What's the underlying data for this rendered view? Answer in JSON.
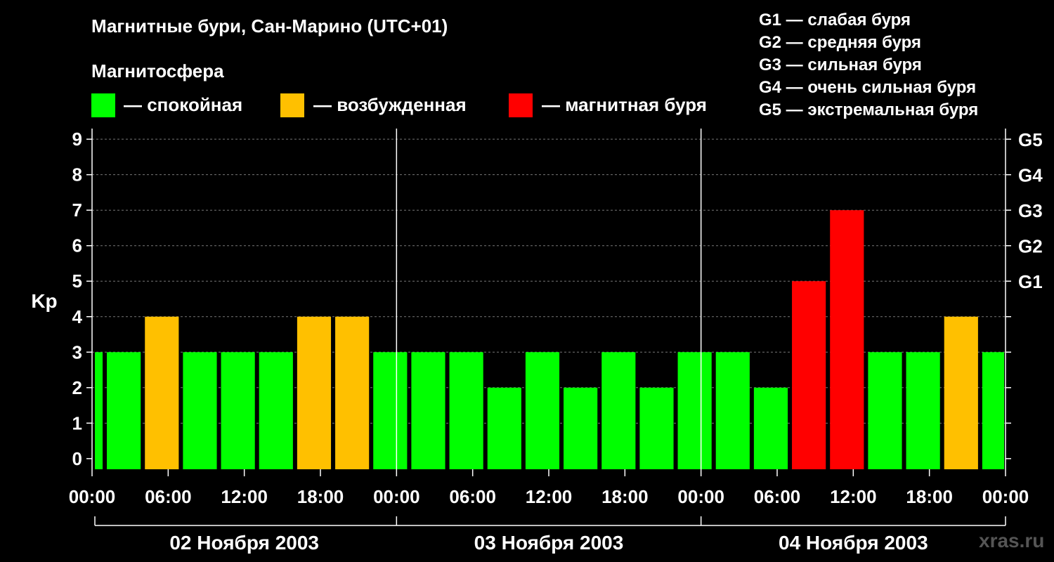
{
  "header": {
    "title": "Магнитные бури, Сан-Марино (UTC+01)",
    "magnetosphere_label": "Магнитосфера"
  },
  "legend": [
    {
      "label": "— спокойная",
      "color": "#00ff00"
    },
    {
      "label": "— возбужденная",
      "color": "#ffc000"
    },
    {
      "label": "— магнитная буря",
      "color": "#ff0000"
    }
  ],
  "g_scale_legend": [
    "G1 — слабая буря",
    "G2 — средняя буря",
    "G3 — сильная буря",
    "G4 — очень сильная буря",
    "G5 — экстремальная буря"
  ],
  "watermark": "xras.ru",
  "chart_data": {
    "type": "bar",
    "ylabel": "Kp",
    "ylim": [
      -0.3,
      9.3
    ],
    "y_ticks": [
      0,
      1,
      2,
      3,
      4,
      5,
      6,
      7,
      8,
      9
    ],
    "g_levels": [
      {
        "label": "G1",
        "kp": 5
      },
      {
        "label": "G2",
        "kp": 6
      },
      {
        "label": "G3",
        "kp": 7
      },
      {
        "label": "G4",
        "kp": 8
      },
      {
        "label": "G5",
        "kp": 9
      }
    ],
    "x_start": "2003-11-02 00:00",
    "x_end": "2003-11-05 00:00",
    "x_tick_labels": [
      "00:00",
      "06:00",
      "12:00",
      "18:00",
      "00:00",
      "06:00",
      "12:00",
      "18:00",
      "00:00",
      "06:00",
      "12:00",
      "18:00",
      "00:00"
    ],
    "days": [
      "02 Ноября 2003",
      "03 Ноября 2003",
      "04 Ноября 2003"
    ],
    "grid": true,
    "bars": [
      {
        "start": "2003-11-02 00:00",
        "end": "2003-11-02 01:00",
        "kp": 3,
        "state": "quiet"
      },
      {
        "start": "2003-11-02 01:00",
        "end": "2003-11-02 04:00",
        "kp": 3,
        "state": "quiet"
      },
      {
        "start": "2003-11-02 04:00",
        "end": "2003-11-02 07:00",
        "kp": 4,
        "state": "active"
      },
      {
        "start": "2003-11-02 07:00",
        "end": "2003-11-02 10:00",
        "kp": 3,
        "state": "quiet"
      },
      {
        "start": "2003-11-02 10:00",
        "end": "2003-11-02 13:00",
        "kp": 3,
        "state": "quiet"
      },
      {
        "start": "2003-11-02 13:00",
        "end": "2003-11-02 16:00",
        "kp": 3,
        "state": "quiet"
      },
      {
        "start": "2003-11-02 16:00",
        "end": "2003-11-02 19:00",
        "kp": 4,
        "state": "active"
      },
      {
        "start": "2003-11-02 19:00",
        "end": "2003-11-02 22:00",
        "kp": 4,
        "state": "active"
      },
      {
        "start": "2003-11-02 22:00",
        "end": "2003-11-03 01:00",
        "kp": 3,
        "state": "quiet"
      },
      {
        "start": "2003-11-03 01:00",
        "end": "2003-11-03 04:00",
        "kp": 3,
        "state": "quiet"
      },
      {
        "start": "2003-11-03 04:00",
        "end": "2003-11-03 07:00",
        "kp": 3,
        "state": "quiet"
      },
      {
        "start": "2003-11-03 07:00",
        "end": "2003-11-03 10:00",
        "kp": 2,
        "state": "quiet"
      },
      {
        "start": "2003-11-03 10:00",
        "end": "2003-11-03 13:00",
        "kp": 3,
        "state": "quiet"
      },
      {
        "start": "2003-11-03 13:00",
        "end": "2003-11-03 16:00",
        "kp": 2,
        "state": "quiet"
      },
      {
        "start": "2003-11-03 16:00",
        "end": "2003-11-03 19:00",
        "kp": 3,
        "state": "quiet"
      },
      {
        "start": "2003-11-03 19:00",
        "end": "2003-11-03 22:00",
        "kp": 2,
        "state": "quiet"
      },
      {
        "start": "2003-11-03 22:00",
        "end": "2003-11-04 01:00",
        "kp": 3,
        "state": "quiet"
      },
      {
        "start": "2003-11-04 01:00",
        "end": "2003-11-04 04:00",
        "kp": 3,
        "state": "quiet"
      },
      {
        "start": "2003-11-04 04:00",
        "end": "2003-11-04 07:00",
        "kp": 2,
        "state": "quiet"
      },
      {
        "start": "2003-11-04 07:00",
        "end": "2003-11-04 10:00",
        "kp": 5,
        "state": "storm"
      },
      {
        "start": "2003-11-04 10:00",
        "end": "2003-11-04 13:00",
        "kp": 7,
        "state": "storm"
      },
      {
        "start": "2003-11-04 13:00",
        "end": "2003-11-04 16:00",
        "kp": 3,
        "state": "quiet"
      },
      {
        "start": "2003-11-04 16:00",
        "end": "2003-11-04 19:00",
        "kp": 3,
        "state": "quiet"
      },
      {
        "start": "2003-11-04 19:00",
        "end": "2003-11-04 22:00",
        "kp": 4,
        "state": "active"
      },
      {
        "start": "2003-11-04 22:00",
        "end": "2003-11-05 00:00",
        "kp": 3,
        "state": "quiet"
      }
    ],
    "state_colors": {
      "quiet": "#00ff00",
      "active": "#ffc000",
      "storm": "#ff0000"
    }
  }
}
